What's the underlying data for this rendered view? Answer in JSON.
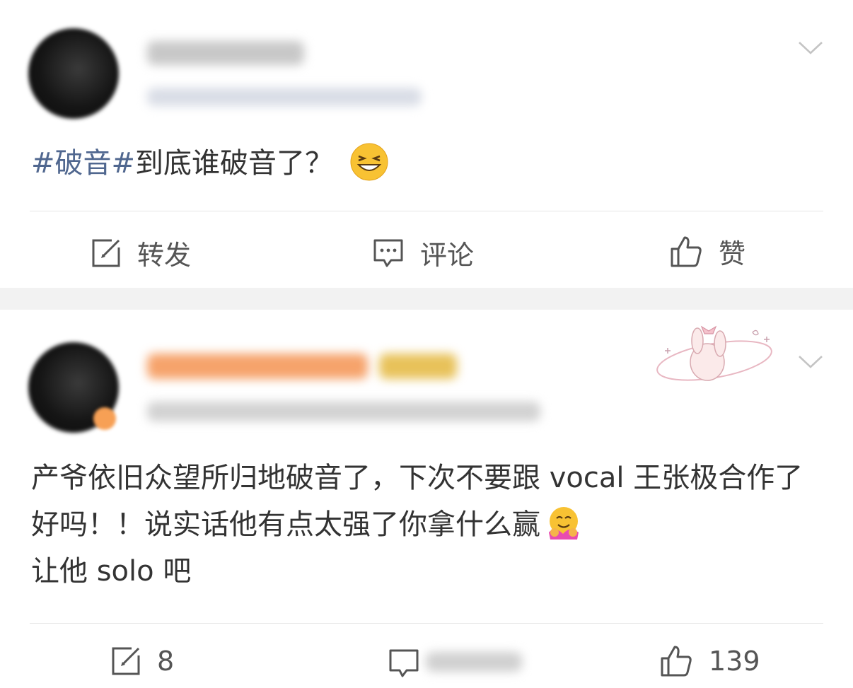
{
  "post1": {
    "content_tag": "#破音#",
    "content_text": "到底谁破音了？",
    "emoji": "grinning-face-icon",
    "actions": {
      "repost_label": "转发",
      "comment_label": "评论",
      "like_label": "赞"
    }
  },
  "post2": {
    "content_text": "产爷依旧众望所归地破音了，下次不要跟 vocal 王张极合作了好吗！！说实话他有点太强了你拿什么赢",
    "content_tail": "让他 solo 吧",
    "emoji": "hugging-face-icon",
    "decoration": "bunny-sticker-icon",
    "actions": {
      "repost_count": "8",
      "like_count": "139"
    }
  },
  "colors": {
    "hashtag": "#50678f",
    "separator": "#f2f2f2",
    "username_orange": "#f6a36b"
  }
}
